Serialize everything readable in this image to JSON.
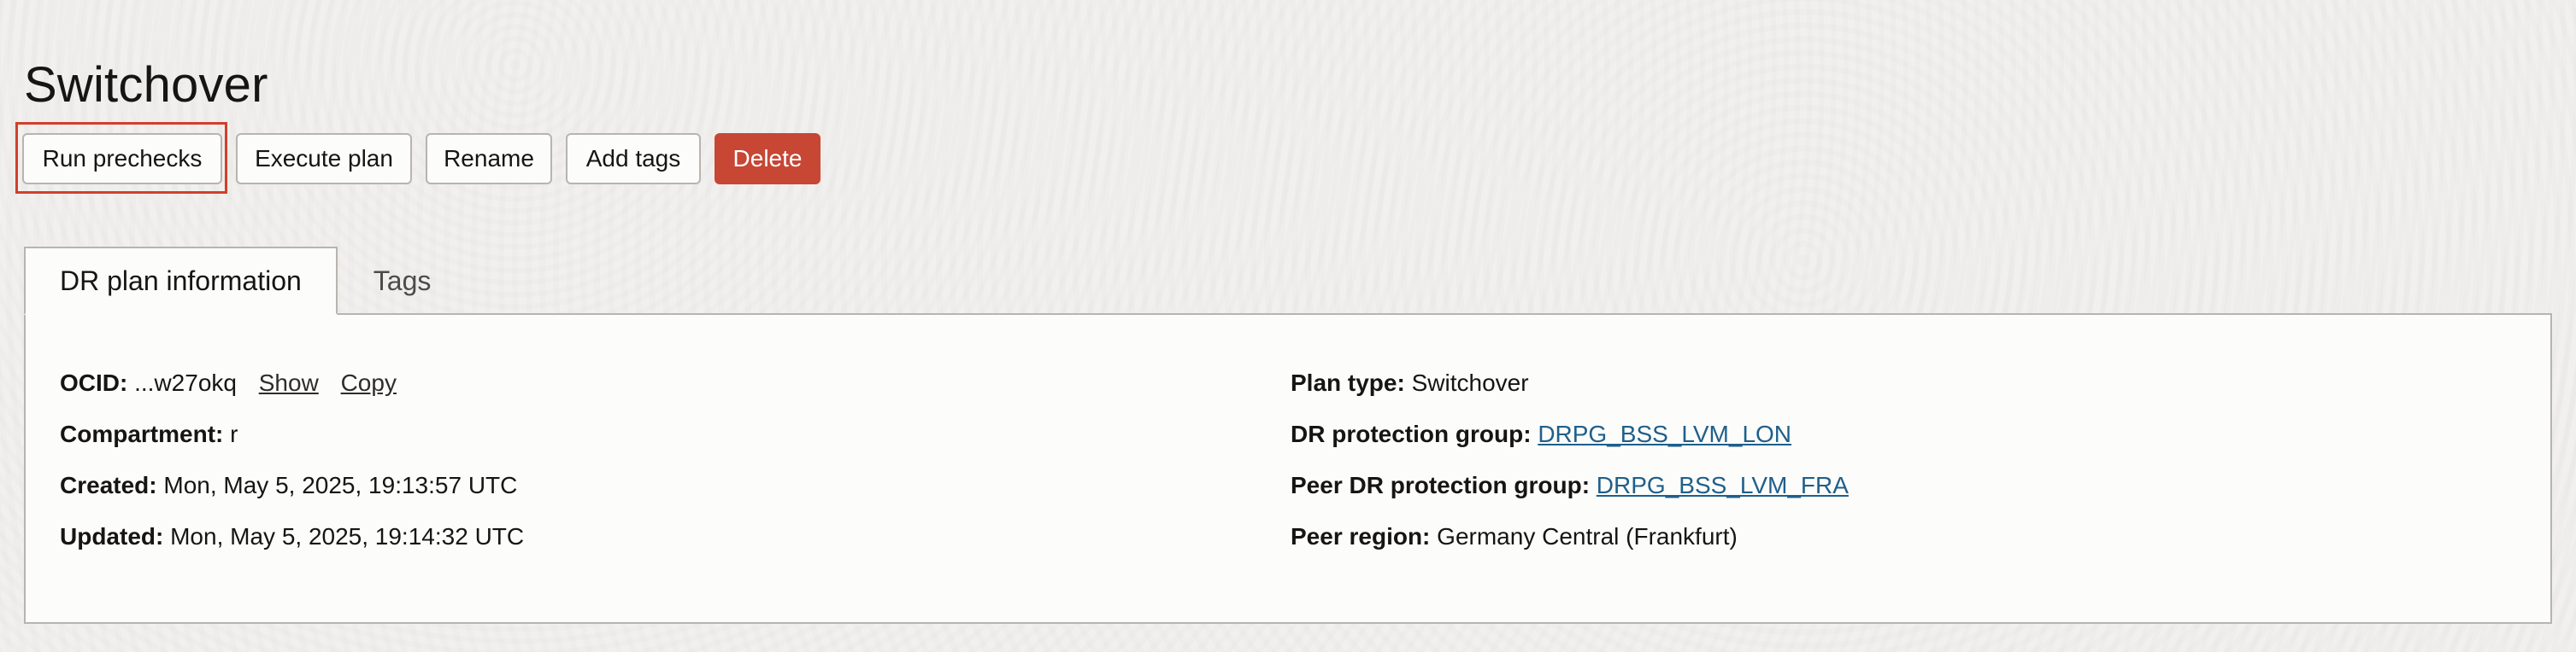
{
  "page": {
    "title": "Switchover"
  },
  "toolbar": {
    "run_prechecks": "Run prechecks",
    "execute_plan": "Execute plan",
    "rename": "Rename",
    "add_tags": "Add tags",
    "delete": "Delete"
  },
  "tabs": [
    {
      "label": "DR plan information",
      "active": true
    },
    {
      "label": "Tags",
      "active": false
    }
  ],
  "info": {
    "ocid_label": "OCID:",
    "ocid_value": "...w27okq",
    "show_link": "Show",
    "copy_link": "Copy",
    "compartment_label": "Compartment:",
    "compartment_value": "r",
    "created_label": "Created:",
    "created_value": "Mon, May 5, 2025, 19:13:57 UTC",
    "updated_label": "Updated:",
    "updated_value": "Mon, May 5, 2025, 19:14:32 UTC",
    "plan_type_label": "Plan type:",
    "plan_type_value": "Switchover",
    "dr_group_label": "DR protection group:",
    "dr_group_value": "DRPG_BSS_LVM_LON",
    "peer_group_label": "Peer DR protection group:",
    "peer_group_value": "DRPG_BSS_LVM_FRA",
    "peer_region_label": "Peer region:",
    "peer_region_value": "Germany Central (Frankfurt)"
  },
  "colors": {
    "delete_button": "#c74634",
    "highlight_border": "#d23f2b",
    "link": "#1f5f8b",
    "background": "#f1f0ee"
  }
}
